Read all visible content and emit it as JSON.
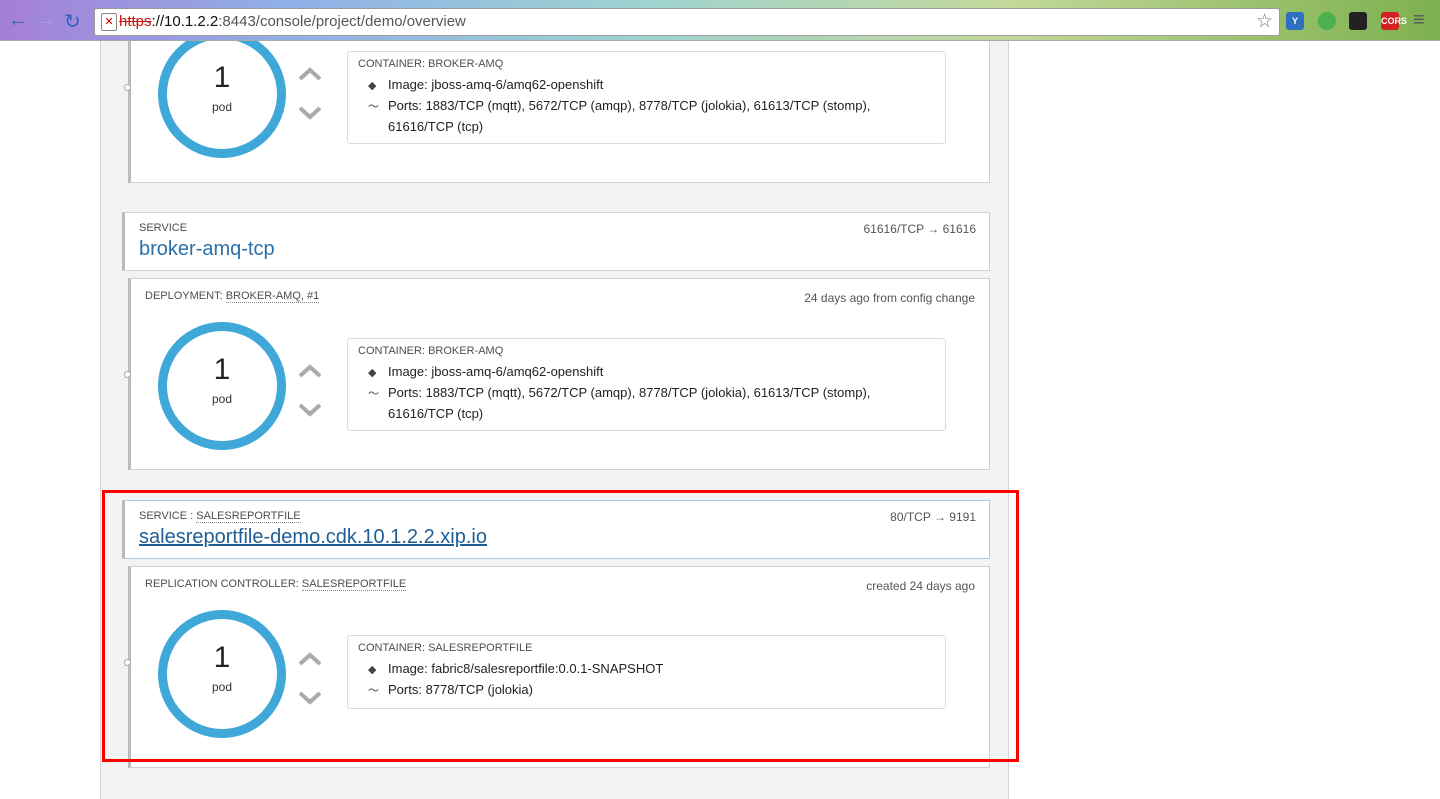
{
  "browser": {
    "url_scheme": "https",
    "url_host": "://10.1.2.2",
    "url_path": ":8443/console/project/demo/overview",
    "extensions": [
      "Y",
      "chrome-ext",
      "mask",
      "CORS"
    ]
  },
  "top_card": {
    "pods": "1",
    "pod_unit": "pod",
    "container_label": "CONTAINER: BROKER-AMQ",
    "image": "Image: jboss-amq-6/amq62-openshift",
    "ports_line1": "Ports: 1883/TCP (mqtt), 5672/TCP (amqp), 8778/TCP (jolokia), 61613/TCP (stomp),",
    "ports_line2": "61616/TCP (tcp)"
  },
  "service_tcp": {
    "label": "SERVICE",
    "name": "broker-amq-tcp",
    "ports": "61616/TCP → 61616",
    "deployment_label": "DEPLOYMENT:",
    "deployment_link": "BROKER-AMQ, #1",
    "deployment_when": "24 days ago from config change",
    "pods": "1",
    "pod_unit": "pod",
    "container_label": "CONTAINER: BROKER-AMQ",
    "image": "Image: jboss-amq-6/amq62-openshift",
    "ports_line1": "Ports: 1883/TCP (mqtt), 5672/TCP (amqp), 8778/TCP (jolokia), 61613/TCP (stomp),",
    "ports_line2": "61616/TCP (tcp)"
  },
  "service_sales": {
    "label": "SERVICE :",
    "label_link": "SALESREPORTFILE",
    "route": "salesreportfile-demo.cdk.10.1.2.2.xip.io",
    "ports": "80/TCP → 9191",
    "rc_label": "REPLICATION CONTROLLER:",
    "rc_link": "SALESREPORTFILE",
    "rc_when": "created 24 days ago",
    "pods": "1",
    "pod_unit": "pod",
    "container_label": "CONTAINER: SALESREPORTFILE",
    "image": "Image: fabric8/salesreportfile:0.0.1-SNAPSHOT",
    "ports_line1": "Ports: 8778/TCP (jolokia)"
  },
  "colors": {
    "accent": "#3fa8d9",
    "link": "#2a6fa8",
    "highlight": "#ff0000"
  }
}
